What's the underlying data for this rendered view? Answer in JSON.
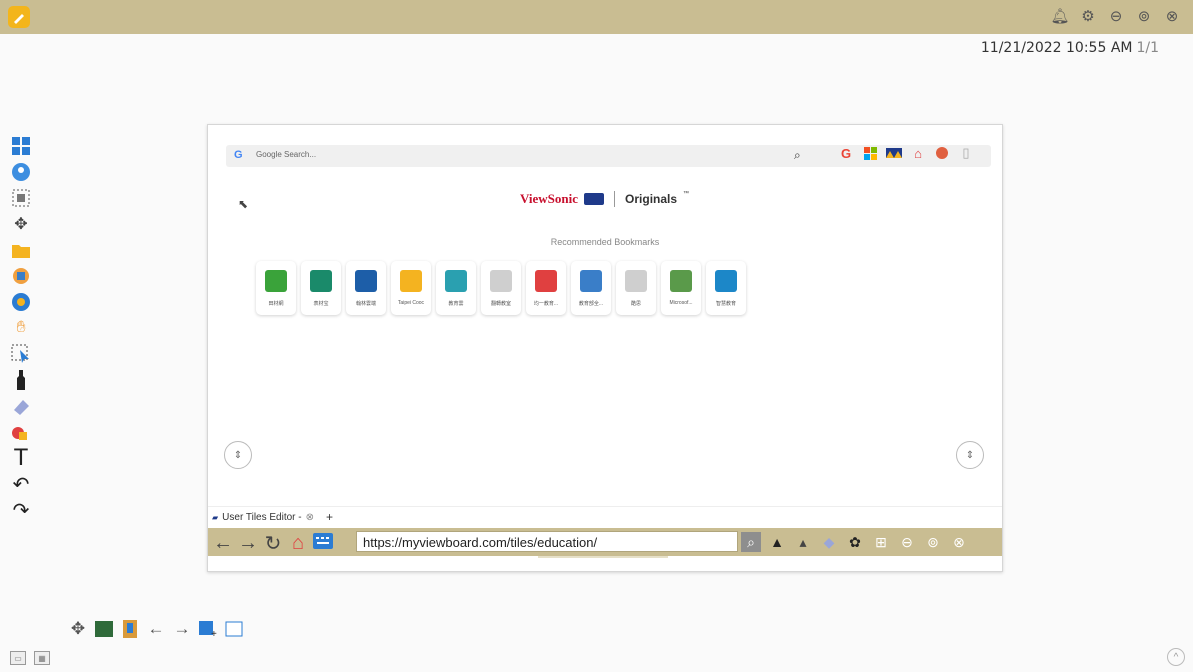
{
  "header": {
    "datetime": "11/21/2022 10:55 AM",
    "page_indicator": "1/1",
    "icons": [
      "bell-icon",
      "gear-icon",
      "minimize-icon",
      "restore-icon",
      "close-icon"
    ]
  },
  "left_toolbar": {
    "tools": [
      "windows-icon",
      "people-icon",
      "screenshot-icon",
      "move-icon",
      "folder-icon",
      "box-icon",
      "browser-icon",
      "hand-icon",
      "select-icon",
      "pen-icon",
      "eraser-icon",
      "shapes-icon",
      "text-icon",
      "undo-icon",
      "redo-icon"
    ]
  },
  "browser": {
    "search_placeholder": "Google Search...",
    "brand_name": "ViewSonic",
    "brand_sub": "Originals",
    "brand_tm": "™",
    "recommended_label": "Recommended Bookmarks",
    "bookmarks": [
      {
        "label": "田材網",
        "color": "#3aa33a"
      },
      {
        "label": "表材宝",
        "color": "#1a8a6a"
      },
      {
        "label": "翰林雲端",
        "color": "#1d5ea8"
      },
      {
        "label": "Taipei Cooc",
        "color": "#f4b320"
      },
      {
        "label": "教育雲",
        "color": "#2aa0b0"
      },
      {
        "label": "翻轉教室",
        "color": "#cfcfcf"
      },
      {
        "label": "均一教育...",
        "color": "#e04040"
      },
      {
        "label": "教育部全...",
        "color": "#3a7ec8"
      },
      {
        "label": "酷思",
        "color": "#cfcfcf"
      },
      {
        "label": "Microsof...",
        "color": "#5a9a4a"
      },
      {
        "label": "智慧教育",
        "color": "#1c87c8"
      }
    ],
    "tab_label": "User Tiles Editor -",
    "url": "https://myviewboard.com/tiles/education/"
  }
}
